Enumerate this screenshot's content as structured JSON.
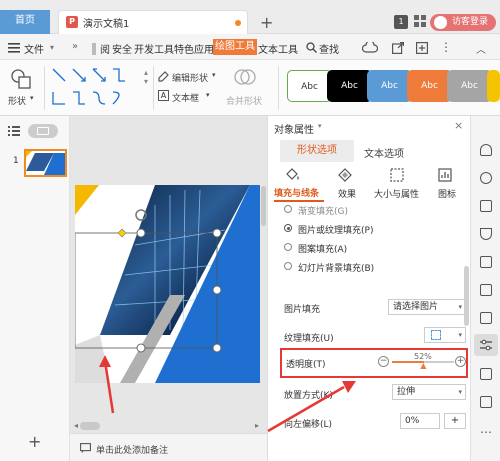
{
  "titlebar": {
    "home_tab": "首页",
    "doc_tab": "演示文稿1",
    "doc_logo": "P",
    "new_tab": "+",
    "badge": "1",
    "login": "访客登录"
  },
  "menubar": {
    "file": "文件",
    "more": "»",
    "items": [
      "阅",
      "安全",
      "开发工具",
      "特色应用",
      "绘图工具",
      "文本工具"
    ],
    "search": "查找"
  },
  "ribbon": {
    "shape_label": "形状",
    "edit_shape": "编辑形状",
    "text_box": "文本框",
    "merge_shape": "合并形状",
    "style_text": "Abc"
  },
  "left": {
    "slide_number": "1",
    "add": "+"
  },
  "canvas": {
    "add_note": "单击此处添加备注"
  },
  "panel": {
    "title": "对象属性",
    "tab_shape": "形状选项",
    "tab_text": "文本选项",
    "sub_tabs": [
      "填充与线条",
      "效果",
      "大小与属性",
      "图标"
    ],
    "options": [
      "渐变填充(G)",
      "图片或纹理填充(P)",
      "图案填充(A)",
      "幻灯片背景填充(B)"
    ],
    "picture_fill_label": "图片填充",
    "picture_fill_value": "请选择图片",
    "texture_fill_label": "纹理填充(U)",
    "transparency_label": "透明度(T)",
    "transparency_value": "52%",
    "transparency_fraction": 0.52,
    "place_label": "放置方式(K)",
    "place_value": "拉伸",
    "offset_left_label": "向左偏移(L)",
    "offset_left_value": "0%"
  },
  "colors": {
    "accent_orange": "#ef7b3b",
    "highlight_red": "#e53935",
    "slide_blue": "#1f6fd1",
    "slide_yellow": "#f5b800"
  }
}
